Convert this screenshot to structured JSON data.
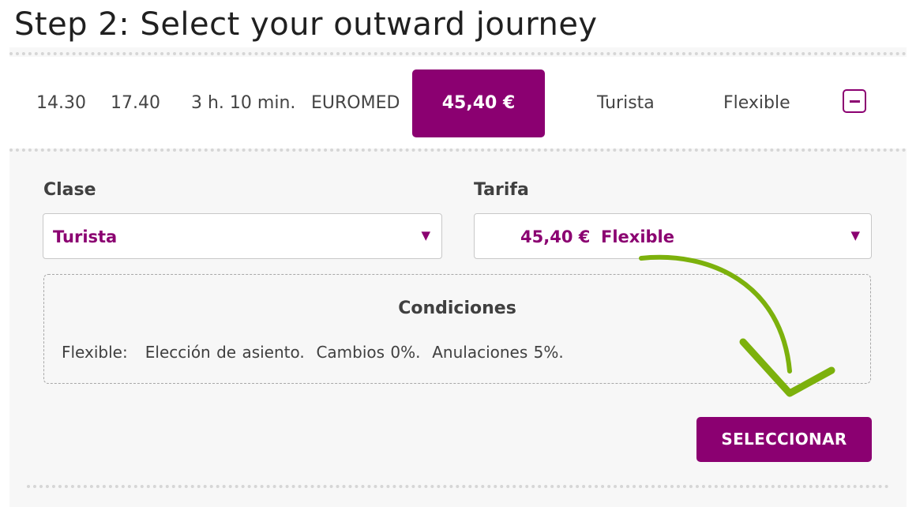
{
  "page": {
    "heading": "Step 2: Select your outward journey"
  },
  "journey": {
    "departure": "14.30",
    "arrival": "17.40",
    "duration": "3 h. 10 min.",
    "train": "EUROMED",
    "price": "45,40 €",
    "class": "Turista",
    "fare": "Flexible",
    "collapse_icon": "minus-square-icon"
  },
  "clase": {
    "label": "Clase",
    "selected": "Turista"
  },
  "tarifa": {
    "label": "Tarifa",
    "selected_price": "45,40 €",
    "selected_fare": "Flexible"
  },
  "conditions": {
    "title": "Condiciones",
    "text": "Flexible:   Elección de asiento.  Cambios 0%.  Anulaciones 5%."
  },
  "actions": {
    "select_label": "SELECCIONAR"
  },
  "colors": {
    "accent": "#8b0071",
    "annotation_arrow": "#7cb10c",
    "panel_bg": "#f7f7f7"
  }
}
